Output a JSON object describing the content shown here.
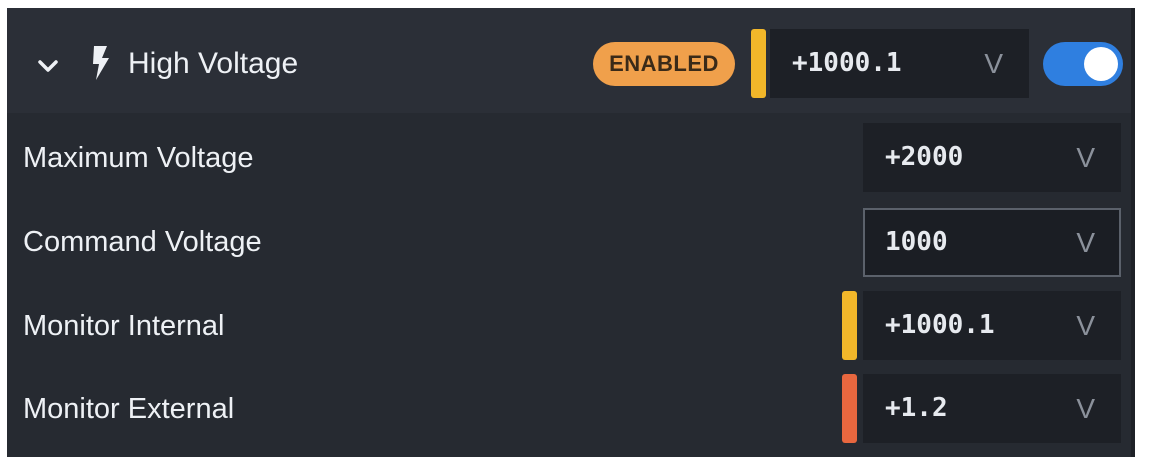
{
  "header": {
    "title": "High Voltage",
    "status_badge": "ENABLED",
    "readout_value": "+1000.1",
    "readout_unit": "V",
    "toggle_on": true,
    "icons": {
      "expand": "chevron-down-icon",
      "section": "lightning-bolt-icon"
    }
  },
  "rows": [
    {
      "label": "Maximum Voltage",
      "value": "+2000",
      "unit": "V",
      "editable": false,
      "status_color": null
    },
    {
      "label": "Command Voltage",
      "value": "1000",
      "unit": "V",
      "editable": true,
      "status_color": null
    },
    {
      "label": "Monitor Internal",
      "value": "+1000.1",
      "unit": "V",
      "editable": false,
      "status_color": "#f2b72a"
    },
    {
      "label": "Monitor External",
      "value": "+1.2",
      "unit": "V",
      "editable": false,
      "status_color": "#e8673f"
    }
  ],
  "colors": {
    "panel_background": "#262a31",
    "header_background": "#2b2f37",
    "badge_background": "#f0a04b",
    "toggle_on": "#2f7fe0",
    "status_warning": "#f2b72a",
    "status_alert": "#e8673f"
  }
}
